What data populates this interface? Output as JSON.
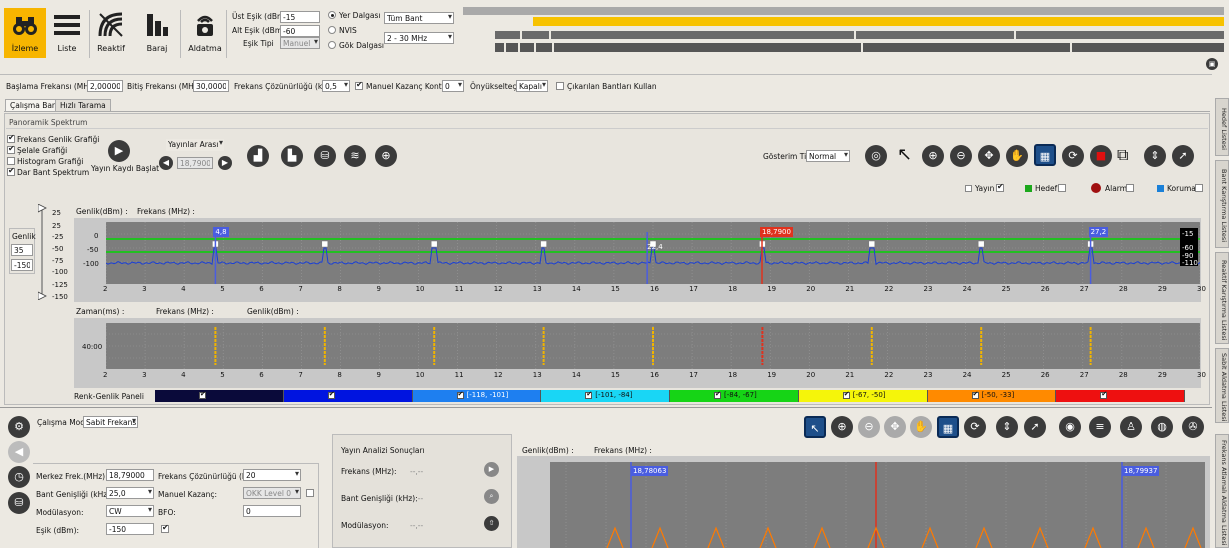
{
  "toolbar": {
    "buttons": [
      {
        "label": "İzleme"
      },
      {
        "label": "Liste"
      },
      {
        "label": "Reaktif"
      },
      {
        "label": "Baraj"
      },
      {
        "label": "Aldatma"
      }
    ],
    "upper_threshold_label": "Üst Eşik (dBm)",
    "upper_threshold_value": "-15",
    "lower_threshold_label": "Alt Eşik (dBm)",
    "lower_threshold_value": "-60",
    "threshold_type_label": "Eşik Tipi",
    "threshold_type_value": "Manuel",
    "wave_options": [
      "Yer Dalgası",
      "NVIS",
      "Gök Dalgası"
    ],
    "band_select": "Tüm Bant",
    "range_select": "2 - 30 MHz"
  },
  "params": {
    "start_freq_label": "Başlama Frekansı (MHz)",
    "start_freq_value": "2,00000",
    "stop_freq_label": "Bitiş Frekansı (MHz)",
    "stop_freq_value": "30,00000",
    "resolution_label": "Frekans Çözünürlüğü (kHz)",
    "resolution_value": "0,5",
    "manual_gain_label": "Manuel Kazanç Kontrol",
    "manual_gain_value": "0",
    "preamp_label": "Önyükselteç:",
    "preamp_value": "Kapalı",
    "excluded_bands_label": "Çıkarılan Bantları Kullan"
  },
  "tabs": [
    "Çalışma Bandı",
    "Hızlı Tarama"
  ],
  "panorama": {
    "title": "Panoramik Spektrum",
    "checks": [
      "Frekans Genlik Grafiği",
      "Şelale Grafiği",
      "Histogram Grafiği",
      "Dar Bant Spektrum"
    ],
    "record_label": "Yayın Kaydı Başlat",
    "nav_select": "Yayınlar Arası",
    "nav_value": "18,79000",
    "display_type_label": "Gösterim Tipi",
    "display_type_value": "Normal",
    "legend": [
      "Yayın",
      "Hedef",
      "Alarm",
      "Koruma"
    ]
  },
  "gain": {
    "label": "Genlik",
    "top_value": "35",
    "bottom_value": "-150",
    "scale": [
      "25",
      "-25",
      "-50",
      "-75",
      "-100",
      "-125",
      "-150"
    ]
  },
  "spectrum": {
    "header_amp": "Genlik(dBm) :",
    "header_freq": "Frekans (MHz) :",
    "y_ticks": [
      "0",
      "-50",
      "-100"
    ],
    "right_values": [
      "-15",
      "-60",
      "-90",
      "-110"
    ],
    "markers": [
      {
        "label": "4,8",
        "freq": 4.8
      },
      {
        "label": "22,4",
        "freq": 15.85
      },
      {
        "label": "18,7900",
        "freq": 18.79
      },
      {
        "label": "27,2",
        "freq": 27.2
      }
    ],
    "peaks": [
      4.8,
      7.6,
      10.4,
      13.2,
      16.0,
      18.8,
      21.6,
      24.4,
      27.2
    ],
    "x_ticks": [
      "2",
      "3",
      "4",
      "5",
      "6",
      "7",
      "8",
      "9",
      "10",
      "11",
      "12",
      "13",
      "14",
      "15",
      "16",
      "17",
      "18",
      "19",
      "20",
      "21",
      "22",
      "23",
      "24",
      "25",
      "26",
      "27",
      "28",
      "29",
      "30"
    ]
  },
  "waterfall": {
    "header_time": "Zaman(ms) :",
    "header_freq": "Frekans (MHz) :",
    "header_amp": "Genlik(dBm) :",
    "y_tick": "40:00"
  },
  "color_panel": {
    "label": "Renk-Genlik Paneli",
    "bands": [
      {
        "range": "",
        "color": "#0a0a3a"
      },
      {
        "range": "",
        "color": "#0014e0"
      },
      {
        "range": "[-118, -101]",
        "color": "#1e7ff0"
      },
      {
        "range": "[-101, -84]",
        "color": "#19d6f5"
      },
      {
        "range": "[-84, -67]",
        "color": "#16d416"
      },
      {
        "range": "[-67, -50]",
        "color": "#f5f50a"
      },
      {
        "range": "[-50, -33]",
        "color": "#ff8a00"
      },
      {
        "range": "",
        "color": "#ee1010"
      }
    ]
  },
  "bottom": {
    "mode_label": "Çalışma Modu",
    "mode_value": "Sabit Frekans",
    "center_freq_label": "Merkez Frek.(MHz):",
    "center_freq_value": "18,79000",
    "res_label": "Frekans Çözünürlüğü (Hz)",
    "res_value": "20",
    "bw_label": "Bant Genişliği (kHz):",
    "bw_value": "25,0",
    "manual_gain_label": "Manuel Kazanç:",
    "manual_gain_value": "OKK Level 0",
    "mod_label": "Modülasyon:",
    "mod_value": "CW",
    "bfo_label": "BFO:",
    "bfo_value": "0",
    "threshold_label": "Eşik (dBm):",
    "threshold_value": "-150",
    "analysis_title": "Yayın Analizi Sonuçları",
    "analysis_freq": "Frekans (MHz):",
    "analysis_bw": "Bant Genişliği (kHz):",
    "analysis_mod": "Modülasyon:",
    "analysis_placeholder": "--,--",
    "nb_header_amp": "Genlik(dBm) :",
    "nb_header_freq": "Frekans (MHz) :",
    "nb_marker_left": "18,78063",
    "nb_marker_right": "18,79937"
  },
  "side_tabs": [
    "Hedef Listesi",
    "Bant Karıştırma Listesi",
    "Reaktif Karıştırma Listesi",
    "Sabit Aldatma Listesi",
    "Frekans Atlamalı Aldatma Listesi"
  ],
  "colors": {
    "accent": "#f7b500",
    "plot_bg": "#7d7d7d",
    "green_line": "#22c022",
    "trace": "#1a3fd6",
    "marker_red": "#e0321e",
    "marker_blue": "#4a5de0"
  }
}
